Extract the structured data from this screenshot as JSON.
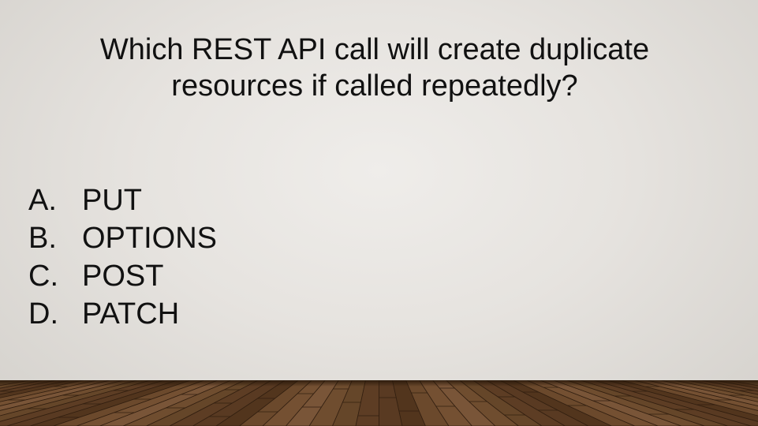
{
  "slide": {
    "question": "Which REST API call will create duplicate resources if called repeatedly?",
    "answers": [
      {
        "letter": "A.",
        "text": "PUT"
      },
      {
        "letter": "B.",
        "text": "OPTIONS"
      },
      {
        "letter": "C.",
        "text": "POST"
      },
      {
        "letter": "D.",
        "text": "PATCH"
      }
    ]
  },
  "colors": {
    "background": "#e6e3df",
    "text": "#111111",
    "floor_wood": "#6b4a2c"
  }
}
